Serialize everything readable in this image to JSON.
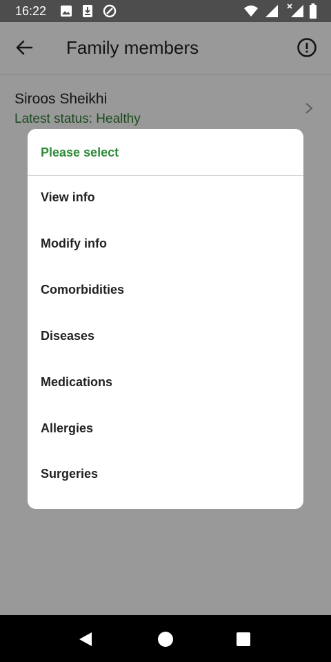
{
  "status_bar": {
    "time": "16:22",
    "icons": [
      "image-icon",
      "download-icon",
      "at-sign-icon",
      "wifi-icon",
      "signal-icon",
      "signal-x-icon",
      "battery-icon"
    ]
  },
  "app_bar": {
    "title": "Family members",
    "back_icon": "arrow-left-icon",
    "info_icon": "exclamation-circle-icon"
  },
  "member": {
    "name": "Siroos Sheikhi",
    "status": "Latest status: Healthy"
  },
  "dialog": {
    "title": "Please select",
    "options": [
      {
        "label": "View info"
      },
      {
        "label": "Modify info"
      },
      {
        "label": "Comorbidities"
      },
      {
        "label": "Diseases"
      },
      {
        "label": "Medications"
      },
      {
        "label": "Allergies"
      },
      {
        "label": "Surgeries"
      }
    ]
  },
  "nav_bar": {
    "icons": [
      "nav-back-icon",
      "nav-home-icon",
      "nav-recents-icon"
    ]
  },
  "colors": {
    "accent_green": "#2e8b3a",
    "status_green": "#2e7d32",
    "status_bar": "#4d4d4d",
    "nav_bar": "#000000"
  }
}
